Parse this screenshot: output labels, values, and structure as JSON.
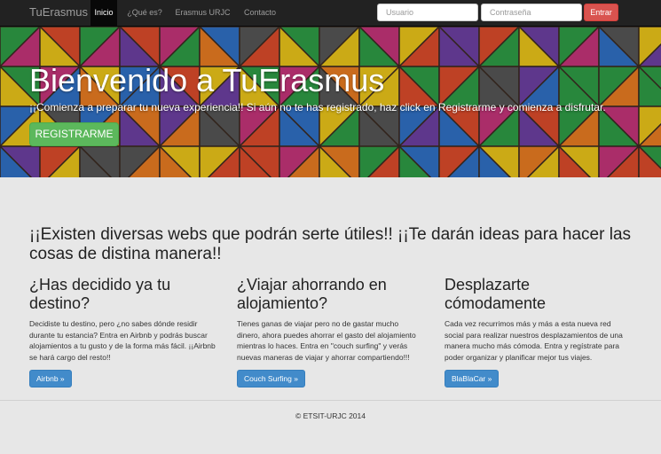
{
  "navbar": {
    "brand": "TuErasmus",
    "items": [
      {
        "label": "Inicio",
        "active": true
      },
      {
        "label": "¿Qué es?",
        "active": false
      },
      {
        "label": "Erasmus URJC",
        "active": false
      },
      {
        "label": "Contacto",
        "active": false
      }
    ],
    "login": {
      "user_placeholder": "Usuario",
      "password_placeholder": "Contraseña",
      "submit_label": "Entrar"
    }
  },
  "hero": {
    "title": "Bienvenido a TuErasmus",
    "subtitle": "¡¡Comienza a preparar tu nueva experiencia!! Si aún no te has registrado, haz click en Registrarme y comienza a disfrutar.",
    "register_label": "REGISTRARME"
  },
  "main": {
    "lead": "¡¡Existen diversas webs que podrán serte útiles!! ¡¡Te darán ideas para hacer las cosas de distina manera!!",
    "columns": [
      {
        "heading": "¿Has decidido ya tu destino?",
        "text": "Decidiste tu destino, pero ¿no sabes dónde residir durante tu estancia? Entra en Airbnb y podrás buscar alojamientos a tu gusto y de la forma más fácil. ¡¡Airbnb se hará cargo del resto!!",
        "button": "Airbnb »"
      },
      {
        "heading": "¿Viajar ahorrando en alojamiento?",
        "text": "Tienes ganas de viajar pero no de gastar mucho dinero, ahora puedes ahorrar el gasto del alojamiento mientras lo haces. Entra en \"couch surfing\" y verás nuevas maneras de viajar y ahorrar compartiendo!!!",
        "button": "Couch Surfing »"
      },
      {
        "heading": "Desplazarte cómodamente",
        "text": "Cada vez recurrimos más y más a esta nueva red social para realizar nuestros desplazamientos de una manera mucho más cómoda. Entra y regístrate para poder organizar y planificar mejor tus viajes.",
        "button": "BlaBlaCar »"
      }
    ]
  },
  "footer": {
    "text": "© ETSIT-URJC 2014"
  },
  "colors": {
    "navbar_bg": "#222222",
    "accent_danger": "#d9534f",
    "accent_success": "#5cb85c",
    "accent_primary": "#428bca",
    "hero_palette": [
      "#d94a2b",
      "#e8c21a",
      "#2f6fc2",
      "#2e9a45",
      "#c23478",
      "#555555",
      "#e57a22",
      "#6b3fa0"
    ]
  }
}
